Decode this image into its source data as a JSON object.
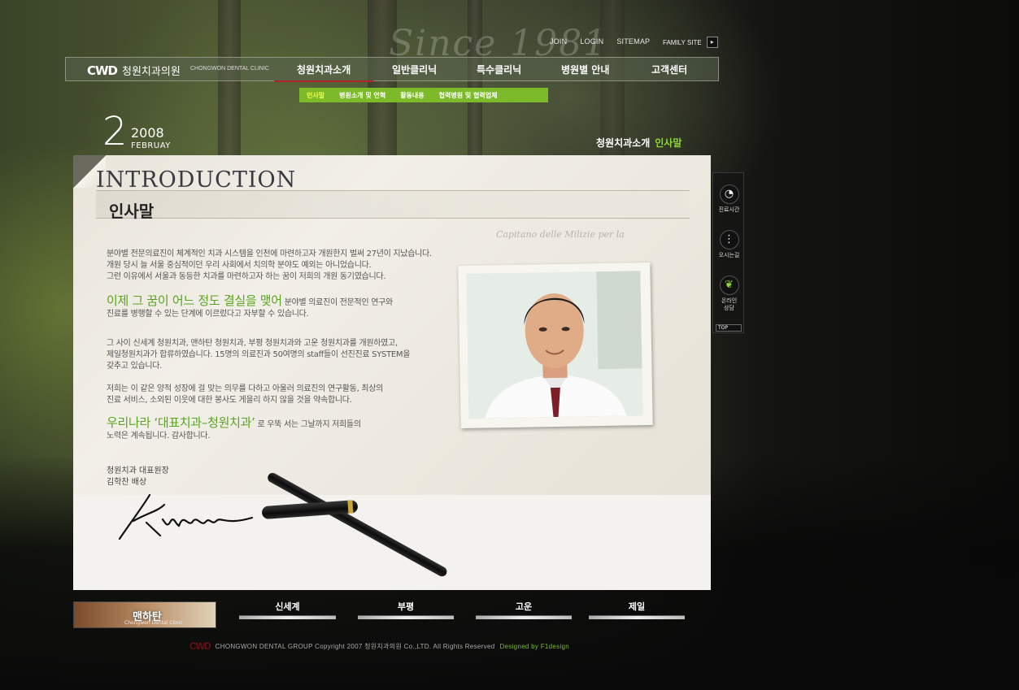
{
  "header": {
    "since": "Since 1981",
    "links": [
      "JOIN",
      "LOGIN",
      "SITEMAP"
    ],
    "family_site": "FAMILY SITE",
    "family_arrow": "▸"
  },
  "logo": {
    "mark": "CWD",
    "name_ko": "청원치과의원",
    "name_en": "CHONGWON DENTAL CLINIC"
  },
  "nav": {
    "items": [
      "청원치과소개",
      "일반클리닉",
      "특수클리닉",
      "병원별 안내",
      "고객센터"
    ],
    "active_index": 0
  },
  "submenu": {
    "items": [
      "인사말",
      "병원소개 및 연혁",
      "활동내용",
      "협력병원 및 협력업체"
    ],
    "active_index": 0
  },
  "date": {
    "day": "2",
    "year": "2008",
    "month": "FEBRUAY"
  },
  "breadcrumb": {
    "parent": "청원치과소개",
    "current": "인사말"
  },
  "content": {
    "heading_en": "INTRODUCTION",
    "heading_ko": "인사말",
    "para1": [
      "분야별 전문의료진이 체계적인 치과 시스템을 인천에 마련하고자 개원한지 벌써 27년이 지났습니다.",
      "개원 당시 늘 서울 중심적이던 우리 사회에서 치의학 분야도 예외는 아니었습니다.",
      "그런 이유에서 서울과 동등한 치과를 마련하고자 하는 꿈이 저희의 개원 동기였습니다."
    ],
    "highlight1": "이제 그 꿈이 어느 정도 결실을 맺어",
    "para2_tail": "분야별 의료진이 전문적인 연구와",
    "para2_line2": "진료를 병행할 수 있는 단계에 이르렀다고 자부할 수 있습니다.",
    "para3": [
      "그 사이 신세계 청원치과, 맨하탄 청원치과, 부평 청원치과와 고운 청원치과를 개원하였고,",
      "제일청원치과가 합류하였습니다. 15명의 의료진과 50여명의 staff들이 선진진료 SYSTEM을",
      "갖추고 있습니다."
    ],
    "para4": [
      "저희는 이 같은 양적 성장에 걸 맞는 의무를 다하고 아울러 의료진의 연구활동, 최상의",
      "진료 서비스, 소외된 이웃에 대한 봉사도 게을리 하지 않을 것을 약속합니다."
    ],
    "highlight2": "우리나라 ‘대표치과–청원치과’",
    "para5_tail": "로 우뚝 서는 그날까지 저희들의",
    "para5_line2": "노력은 계속됩니다. 감사합니다.",
    "signer_title": "청원치과 대표원장",
    "signer_name": "김학찬 배상",
    "script_text": "Capitano delle Milizie per la"
  },
  "quick_menu": {
    "items": [
      {
        "label": "진료시간",
        "icon": "clock-icon"
      },
      {
        "label": "오시는길",
        "icon": "traffic-light-icon"
      },
      {
        "label": "온라인 상담",
        "icon": "leaf-icon"
      }
    ],
    "top": "TOP"
  },
  "branches": {
    "main": "맨하탄",
    "main_sub": "Chongwon Dental Clinic",
    "others": [
      "신세계",
      "부평",
      "고운",
      "제일"
    ]
  },
  "footer": {
    "logo": "CWD",
    "copyright": "CHONGWON DENTAL GROUP Copyright 2007 청원치과의원 Co.,LTD. All Rights Reserved",
    "designer": "Designed by F1design"
  },
  "colors": {
    "accent_green": "#7cba2a",
    "active_red": "#b3232a"
  }
}
